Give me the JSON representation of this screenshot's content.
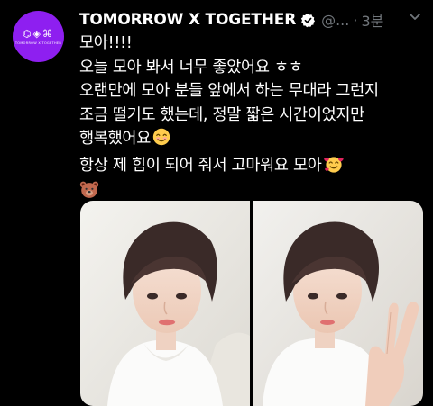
{
  "tweet": {
    "display_name": "TOMORROW X TOGETHER",
    "handle": "@...",
    "separator": "·",
    "time": "3분",
    "more_icon": "chevron-down-icon",
    "avatar": {
      "logo_marks": "⌬◈⌘",
      "logo_text": "TOMORROW X TOGETHER"
    },
    "lines": [
      "모아!!!!",
      "오늘 모아 봐서 너무 좋았어요 ㅎㅎ",
      "오랜만에 모아 분들 앞에서 하는 무대라 그런지",
      "조금 떨기도 했는데, 정말 짧은 시간이었지만",
      "행복했어요",
      "항상 제 힘이 되어 줘서 고마워요 모아"
    ],
    "emojis": [
      "smiling-face-emoji",
      "smiling-face-with-hearts-emoji",
      "bear-face-emoji"
    ]
  },
  "colors": {
    "background": "#000000",
    "avatar_bg": "#8e1ff0",
    "verified": "#1d9bf0",
    "muted_text": "#71767b",
    "text": "#ffffff"
  }
}
